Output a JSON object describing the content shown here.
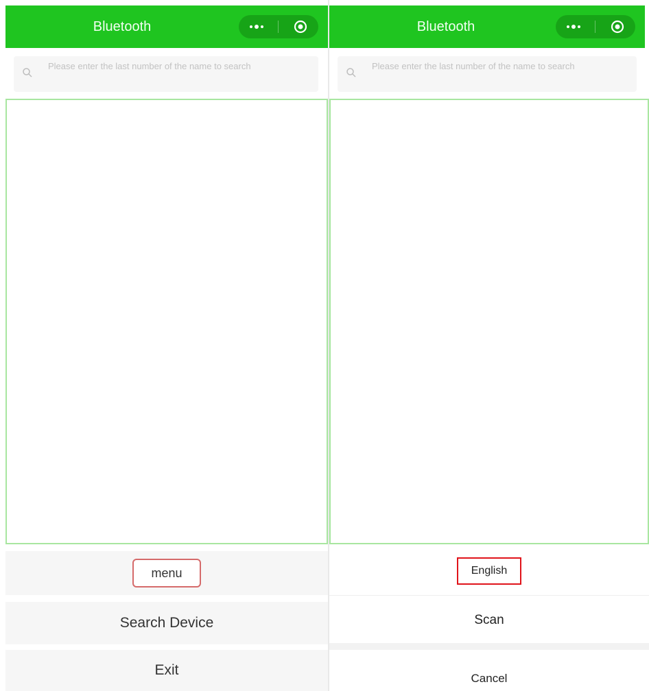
{
  "left_screen": {
    "header": {
      "title": "Bluetooth"
    },
    "search": {
      "placeholder": "Please enter the last number of the name to search"
    },
    "menu_button": {
      "label": "menu"
    },
    "search_device_button": {
      "label": "Search Device"
    },
    "exit_button": {
      "label": "Exit"
    }
  },
  "right_screen": {
    "header": {
      "title": "Bluetooth"
    },
    "search": {
      "placeholder": "Please enter the last number of the name to search"
    },
    "action_sheet": {
      "items": [
        {
          "label": "English"
        },
        {
          "label": "Scan"
        }
      ],
      "cancel_label": "Cancel"
    }
  },
  "icons": {
    "capsule_more": "more-dots-icon",
    "capsule_close": "target-close-icon",
    "search": "search-icon"
  },
  "colors": {
    "header_green": "#1fc520",
    "capsule_green": "#17a417",
    "list_border": "#a8e6a0",
    "highlight_red": "#e0131a",
    "menu_border": "#d56a6a"
  }
}
